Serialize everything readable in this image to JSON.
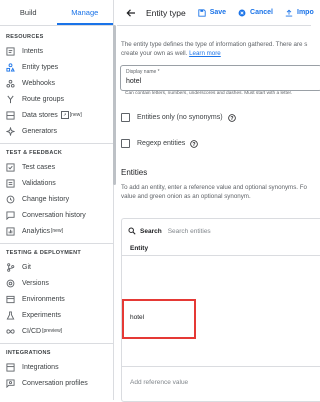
{
  "sidebar": {
    "tabs": [
      {
        "label": "Build"
      },
      {
        "label": "Manage"
      }
    ],
    "sections": [
      {
        "title": "RESOURCES",
        "items": [
          {
            "label": "Intents",
            "icon": "intents-icon"
          },
          {
            "label": "Entity types",
            "icon": "entity-types-icon"
          },
          {
            "label": "Webhooks",
            "icon": "webhooks-icon"
          },
          {
            "label": "Route groups",
            "icon": "route-groups-icon"
          },
          {
            "label": "Data stores",
            "icon": "data-stores-icon",
            "badge": "[new]"
          },
          {
            "label": "Generators",
            "icon": "generators-icon"
          }
        ]
      },
      {
        "title": "TEST & FEEDBACK",
        "items": [
          {
            "label": "Test cases",
            "icon": "test-cases-icon"
          },
          {
            "label": "Validations",
            "icon": "validations-icon"
          },
          {
            "label": "Change history",
            "icon": "change-history-icon"
          },
          {
            "label": "Conversation history",
            "icon": "conversation-history-icon"
          },
          {
            "label": "Analytics",
            "icon": "analytics-icon",
            "badge": "[new]"
          }
        ]
      },
      {
        "title": "TESTING & DEPLOYMENT",
        "items": [
          {
            "label": "Git",
            "icon": "git-icon"
          },
          {
            "label": "Versions",
            "icon": "versions-icon"
          },
          {
            "label": "Environments",
            "icon": "environments-icon"
          },
          {
            "label": "Experiments",
            "icon": "experiments-icon"
          },
          {
            "label": "CI/CD",
            "icon": "ci-cd-icon",
            "badge": "[preview]"
          }
        ]
      },
      {
        "title": "INTEGRATIONS",
        "items": [
          {
            "label": "Integrations",
            "icon": "integrations-icon"
          },
          {
            "label": "Conversation profiles",
            "icon": "conversation-profiles-icon"
          }
        ]
      }
    ]
  },
  "topbar": {
    "title": "Entity type",
    "save_label": "Save",
    "cancel_label": "Cancel",
    "import_label": "Impo"
  },
  "form": {
    "description_line1": "The entity type defines the type of information gathered. There are s",
    "description_line2": "create your own as well.",
    "learn_more": "Learn more",
    "display_name_label": "Display name *",
    "display_name_value": "hotel",
    "display_name_hint": "Can contain letters, numbers, underscores and dashes. Must start with a letter.",
    "checkbox_synonyms": "Entities only (no synonyms)",
    "checkbox_regexp": "Regexp entities"
  },
  "entities": {
    "heading": "Entities",
    "description_line1": "To add an entity, enter a reference value and optional synonyms. Fo",
    "description_line2": "value and green onion as an optional synonym.",
    "search_label": "Search",
    "search_placeholder": "Search entities",
    "column_header": "Entity",
    "rows": [
      "hotel"
    ],
    "add_placeholder": "Add reference value"
  },
  "colors": {
    "accent": "#1a73e8",
    "highlight": "#e53935"
  }
}
